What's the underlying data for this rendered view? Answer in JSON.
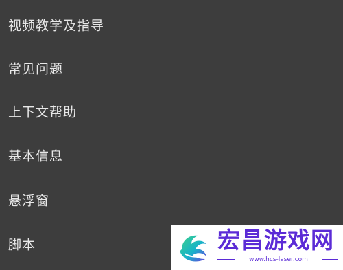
{
  "menu": {
    "items": [
      {
        "label": "视频教学及指导"
      },
      {
        "label": "常见问题"
      },
      {
        "label": "上下文帮助"
      },
      {
        "label": "基本信息"
      },
      {
        "label": "悬浮窗"
      },
      {
        "label": "脚本"
      }
    ]
  },
  "watermark": {
    "title": "宏昌游戏网",
    "url": "www.hcs-laser.com",
    "logo_icon": "dragon-logo-icon"
  },
  "colors": {
    "background": "#3d3d3d",
    "text": "#e8e8e8",
    "watermark_accent": "#5b2bd6"
  }
}
